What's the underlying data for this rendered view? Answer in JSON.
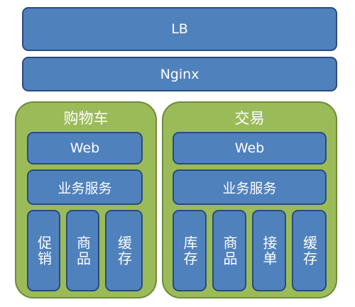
{
  "layers": {
    "lb": "LB",
    "nginx": "Nginx"
  },
  "groups": [
    {
      "title": "购物车",
      "web": "Web",
      "service": "业务服务",
      "modules": [
        "促销",
        "商品",
        "缓存"
      ]
    },
    {
      "title": "交易",
      "web": "Web",
      "service": "业务服务",
      "modules": [
        "库存",
        "商品",
        "接单",
        "缓存"
      ]
    }
  ],
  "colors": {
    "box_fill": "#4f81bd",
    "box_border": "#2a4b7c",
    "group_fill": "#9bbb59",
    "group_border": "#6f8a3a"
  }
}
